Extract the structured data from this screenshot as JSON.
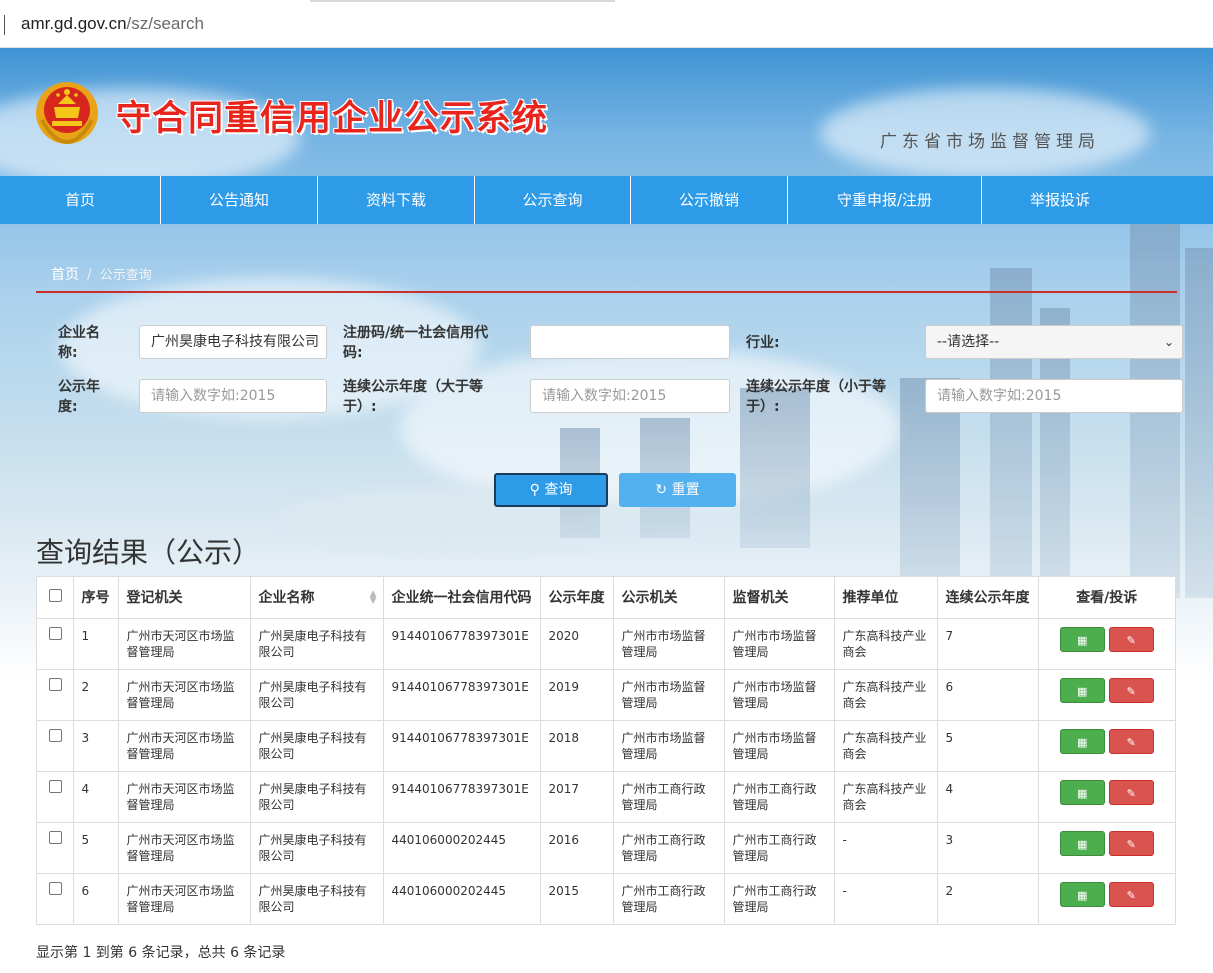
{
  "browser": {
    "url_host": "amr.gd.gov.cn",
    "url_path": "/sz/search"
  },
  "header": {
    "site_title": "守合同重信用企业公示系统",
    "agency": "广东省市场监督管理局",
    "title_color": "#e8251d"
  },
  "nav": {
    "items": [
      "首页",
      "公告通知",
      "资料下载",
      "公示查询",
      "公示撤销",
      "守重申报/注册",
      "举报投诉"
    ],
    "color": "#2e9be8"
  },
  "breadcrumb": {
    "home": "首页",
    "sep": "/",
    "current": "公示查询"
  },
  "form": {
    "company_label": "企业名称:",
    "company_value": "广州昊康电子科技有限公司",
    "regcode_label": "注册码/统一社会信用代码:",
    "regcode_value": "",
    "industry_label": "行业:",
    "industry_value": "--请选择--",
    "year_label": "公示年度:",
    "year_placeholder": "请输入数字如:2015",
    "cont_ge_label": "连续公示年度（大于等于）:",
    "cont_ge_placeholder": "请输入数字如:2015",
    "cont_le_label": "连续公示年度（小于等于）:",
    "cont_le_placeholder": "请输入数字如:2015",
    "search_label": "查询",
    "reset_label": "重置"
  },
  "results": {
    "title": "查询结果（公示）",
    "columns": [
      "序号",
      "登记机关",
      "企业名称",
      "企业统一社会信用代码",
      "公示年度",
      "公示机关",
      "监督机关",
      "推荐单位",
      "连续公示年度",
      "查看/投诉"
    ],
    "rows": [
      {
        "no": "1",
        "reg": "广州市天河区市场监督管理局",
        "name": "广州昊康电子科技有限公司",
        "code": "91440106778397301E",
        "year": "2020",
        "pub": "广州市市场监督管理局",
        "sup": "广州市市场监督管理局",
        "rec": "广东高科技产业商会",
        "cont": "7"
      },
      {
        "no": "2",
        "reg": "广州市天河区市场监督管理局",
        "name": "广州昊康电子科技有限公司",
        "code": "91440106778397301E",
        "year": "2019",
        "pub": "广州市市场监督管理局",
        "sup": "广州市市场监督管理局",
        "rec": "广东高科技产业商会",
        "cont": "6"
      },
      {
        "no": "3",
        "reg": "广州市天河区市场监督管理局",
        "name": "广州昊康电子科技有限公司",
        "code": "91440106778397301E",
        "year": "2018",
        "pub": "广州市市场监督管理局",
        "sup": "广州市市场监督管理局",
        "rec": "广东高科技产业商会",
        "cont": "5"
      },
      {
        "no": "4",
        "reg": "广州市天河区市场监督管理局",
        "name": "广州昊康电子科技有限公司",
        "code": "91440106778397301E",
        "year": "2017",
        "pub": "广州市工商行政管理局",
        "sup": "广州市工商行政管理局",
        "rec": "广东高科技产业商会",
        "cont": "4"
      },
      {
        "no": "5",
        "reg": "广州市天河区市场监督管理局",
        "name": "广州昊康电子科技有限公司",
        "code": "440106000202445",
        "year": "2016",
        "pub": "广州市工商行政管理局",
        "sup": "广州市工商行政管理局",
        "rec": "-",
        "cont": "3"
      },
      {
        "no": "6",
        "reg": "广州市天河区市场监督管理局",
        "name": "广州昊康电子科技有限公司",
        "code": "440106000202445",
        "year": "2015",
        "pub": "广州市工商行政管理局",
        "sup": "广州市工商行政管理局",
        "rec": "-",
        "cont": "2"
      }
    ],
    "footer": "显示第 1 到第 6 条记录，总共 6 条记录",
    "view_color": "#4cae4c",
    "complain_color": "#d9534f"
  }
}
